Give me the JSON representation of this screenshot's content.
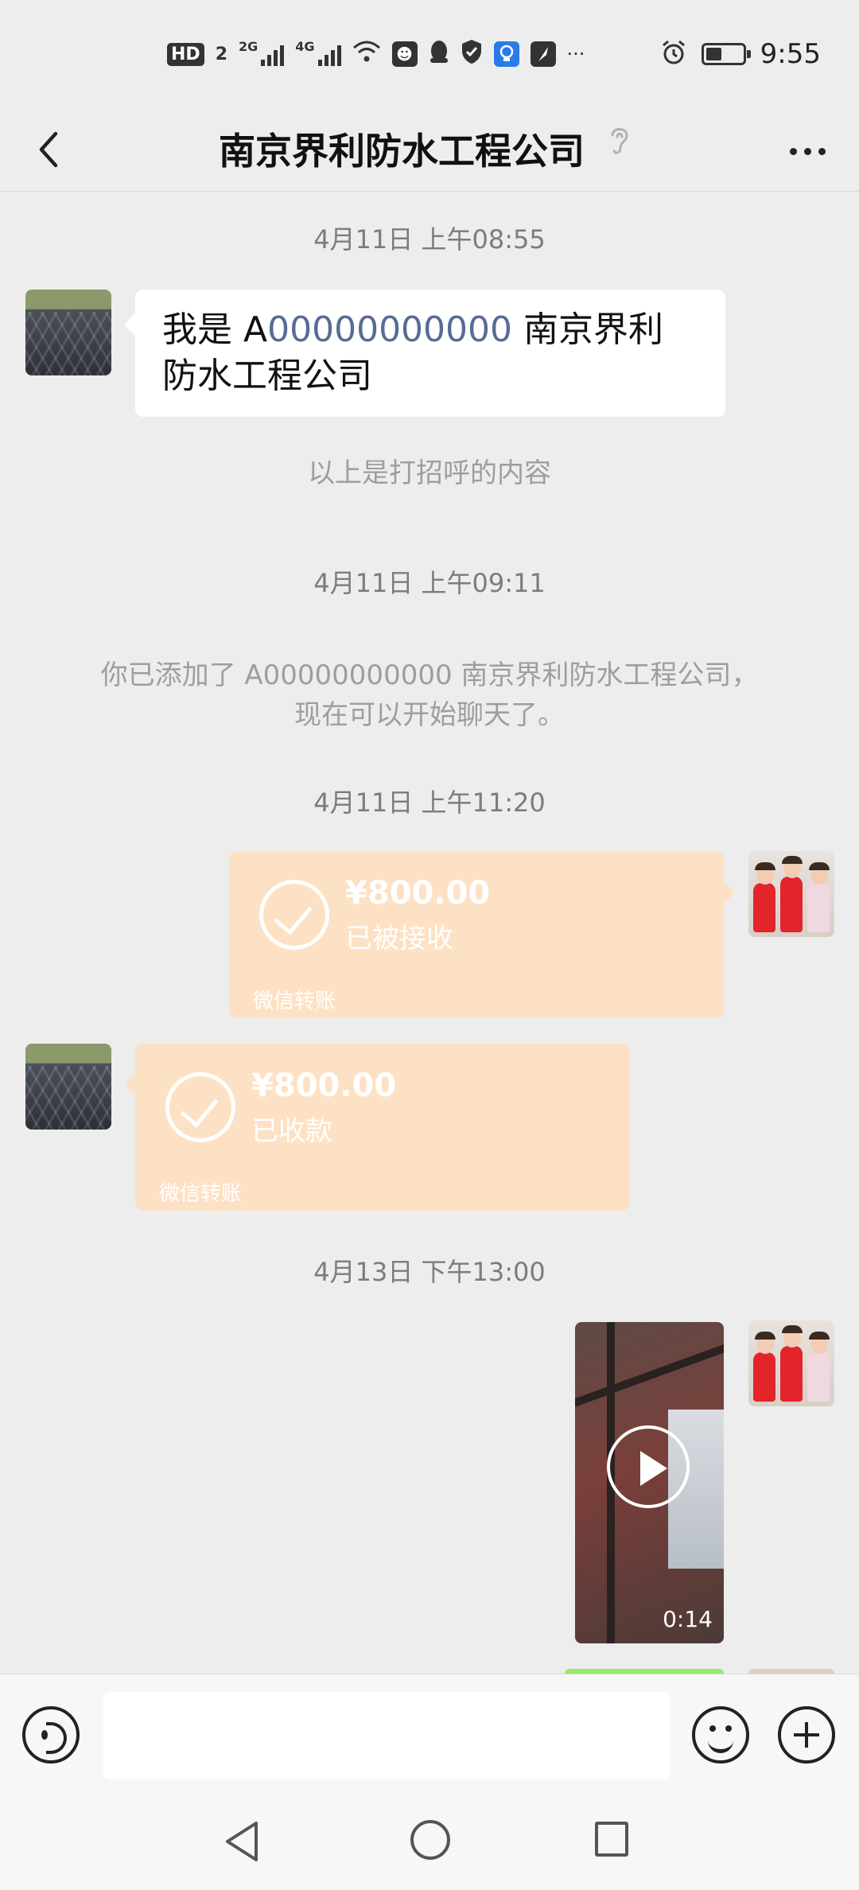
{
  "status_bar": {
    "hd": "HD",
    "sim_slot": "2",
    "net_2g": "2G",
    "net_4g": "4G",
    "more": "···",
    "battery_level": 0.45,
    "time": "9:55"
  },
  "nav": {
    "title": "南京界利防水工程公司"
  },
  "messages": {
    "ts1": "4月11日 上午08:55",
    "greeting_prefix": "我是 A",
    "greeting_account": "00000000000",
    "greeting_suffix": " 南京界利防水工程公司",
    "greeting_note": "以上是打招呼的内容",
    "ts2": "4月11日 上午09:11",
    "added_line1": "你已添加了 A00000000000 南京界利防水工程公司，",
    "added_line2": "现在可以开始聊天了。",
    "ts3": "4月11日 上午11:20",
    "transfer1": {
      "amount": "¥800.00",
      "status": "已被接收",
      "label": "微信转账"
    },
    "transfer2": {
      "amount": "¥800.00",
      "status": "已收款",
      "label": "微信转账"
    },
    "ts4": "4月13日 下午13:00",
    "video_duration": "0:14"
  },
  "colors": {
    "background": "#ededed",
    "transfer_bg": "#fde1c4",
    "account_link": "#576b95",
    "own_bubble": "#95ec69"
  }
}
